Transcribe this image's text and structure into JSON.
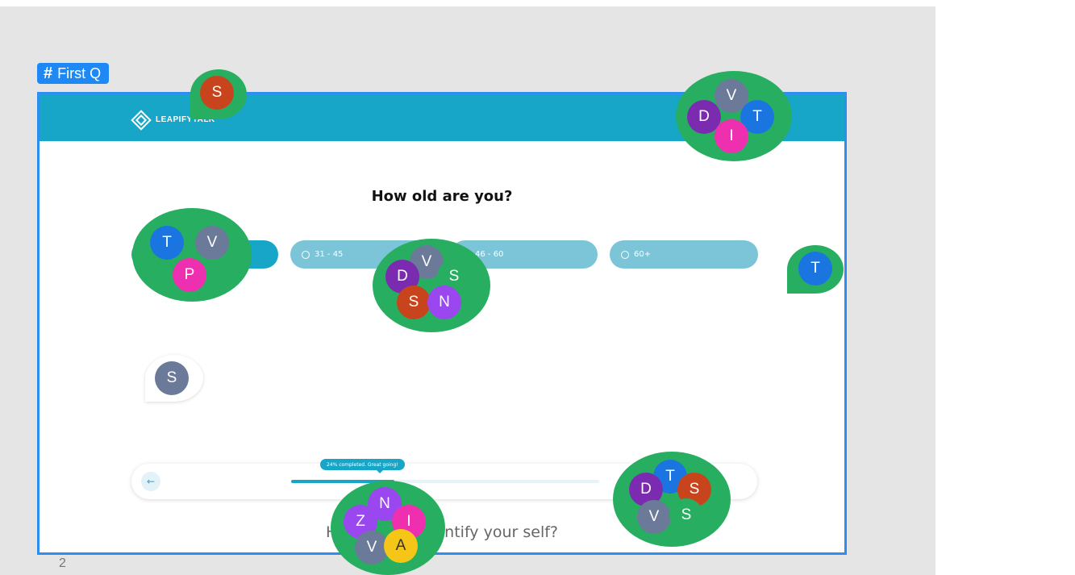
{
  "frame": {
    "label": "First Q",
    "label_icon": "hash-icon",
    "page_number": "2"
  },
  "logo": {
    "text": "LEAPIFYTALK"
  },
  "question": "How old are you?",
  "options": [
    {
      "label": "",
      "selected": true
    },
    {
      "label": "31 - 45",
      "selected": false
    },
    {
      "label": "46 - 60",
      "selected": false
    },
    {
      "label": "60+",
      "selected": false
    }
  ],
  "progress": {
    "tooltip": "24% completed. Great going!",
    "percent": 24,
    "back_icon": "arrow-left-icon"
  },
  "next_question": "How do you identify your self?",
  "colors": {
    "brand": "#18a6c8",
    "selection": "#2f8cf0",
    "collab_green": "#27ae60",
    "canvas": "#e5e5e5"
  },
  "collaborators": {
    "cluster_top_right": [
      "V",
      "D",
      "T",
      "I"
    ],
    "cluster_left": [
      "T",
      "V",
      "P"
    ],
    "cluster_center": [
      "V",
      "D",
      "S",
      "S",
      "N"
    ],
    "cluster_bottom_center": [
      "N",
      "Z",
      "I",
      "V",
      "A"
    ],
    "cluster_bottom_right": [
      "T",
      "D",
      "S",
      "V",
      "S"
    ],
    "pin_top": "S",
    "pin_right": "T",
    "pin_left": "S"
  }
}
